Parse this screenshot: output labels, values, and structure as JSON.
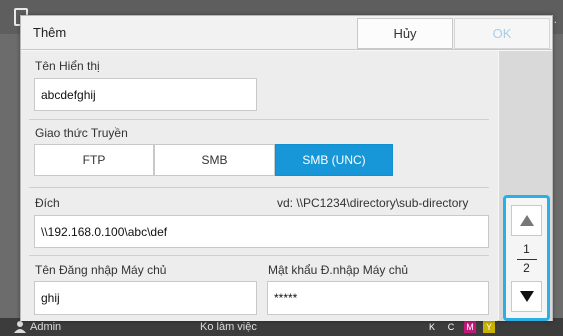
{
  "dialog": {
    "title": "Thêm",
    "cancel_label": "Hủy",
    "ok_label": "OK"
  },
  "display_name": {
    "label": "Tên Hiển thị",
    "value": "abcdefghij"
  },
  "protocol": {
    "label": "Giao thức Truyền",
    "options": [
      "FTP",
      "SMB",
      "SMB (UNC)"
    ],
    "selected": "SMB (UNC)"
  },
  "destination": {
    "label": "Đích",
    "example": "vd: \\\\PC1234\\directory\\sub-directory",
    "value": "\\\\192.168.0.100\\abc\\def"
  },
  "server_login": {
    "label": "Tên Đăng nhập Máy chủ",
    "value": "ghij"
  },
  "server_password": {
    "label": "Mật khẩu Đ.nhập Máy chủ",
    "value": "*****"
  },
  "pagination": {
    "current": "1",
    "total": "2"
  },
  "background": {
    "user": "Admin",
    "status": "Ko làm việc",
    "right_text": "e.",
    "ink_labels": [
      "K",
      "C",
      "M",
      "Y"
    ]
  },
  "colors": {
    "accent": "#1797d8",
    "highlight_border": "#2bb0e6",
    "ok_disabled": "#a7cfe6"
  },
  "icons": [
    "up-arrow-icon",
    "down-arrow-icon",
    "user-icon"
  ]
}
